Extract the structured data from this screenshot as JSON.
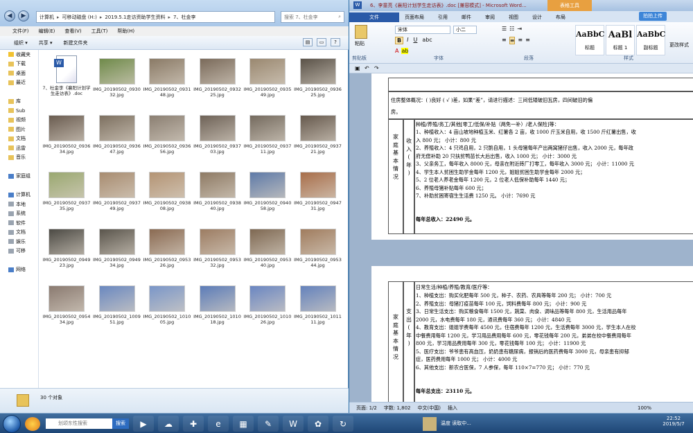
{
  "explorer": {
    "breadcrumb": [
      "计算机",
      "可移动磁盘 (H:)",
      "2019.5.1走访资助学生资料",
      "7、杜金李"
    ],
    "search_placeholder": "搜索 7、杜金李",
    "menu": [
      "文件(F)",
      "编辑(E)",
      "查看(V)",
      "工具(T)",
      "帮助(H)"
    ],
    "toolbar": {
      "organize": "组织 ▾",
      "share": "共享 ▾",
      "new_folder": "新建文件夹"
    },
    "nav": [
      {
        "label": "收藏夹",
        "icon": "star-icon"
      },
      {
        "label": "下载",
        "icon": "folder-icon"
      },
      {
        "label": "桌面",
        "icon": "folder-icon"
      },
      {
        "label": "最近",
        "icon": "folder-icon"
      },
      {
        "label": "",
        "icon": ""
      },
      {
        "label": "库",
        "icon": "library-icon"
      },
      {
        "label": "Sub",
        "icon": "folder-icon"
      },
      {
        "label": "视频",
        "icon": "folder-icon"
      },
      {
        "label": "图片",
        "icon": "folder-icon"
      },
      {
        "label": "文档",
        "icon": "folder-icon"
      },
      {
        "label": "迅雷",
        "icon": "folder-icon"
      },
      {
        "label": "音乐",
        "icon": "folder-icon"
      },
      {
        "label": "",
        "icon": ""
      },
      {
        "label": "家庭组",
        "icon": "homegroup-icon"
      },
      {
        "label": "",
        "icon": ""
      },
      {
        "label": "计算机",
        "icon": "computer-icon"
      },
      {
        "label": "本地",
        "icon": "drive-icon"
      },
      {
        "label": "系统",
        "icon": "drive-icon"
      },
      {
        "label": "软件",
        "icon": "drive-icon"
      },
      {
        "label": "文档",
        "icon": "drive-icon"
      },
      {
        "label": "娱乐",
        "icon": "drive-icon"
      },
      {
        "label": "可移",
        "icon": "drive-icon"
      },
      {
        "label": "",
        "icon": ""
      },
      {
        "label": "网络",
        "icon": "network-icon"
      }
    ],
    "files": [
      {
        "name": "7、杜金李《襄阳计划学生走访表》.doc",
        "kind": "doc"
      },
      {
        "name": "IMG_20190502_093032.jpg",
        "kind": "img",
        "color": "#6f8a4a"
      },
      {
        "name": "IMG_20190502_093148.jpg",
        "kind": "img",
        "color": "#8a7a66"
      },
      {
        "name": "IMG_20190502_093225.jpg",
        "kind": "img",
        "color": "#7a6a5a"
      },
      {
        "name": "IMG_20190502_093549.jpg",
        "kind": "img",
        "color": "#9a8870"
      },
      {
        "name": "IMG_20190502_093625.jpg",
        "kind": "img",
        "color": "#5a5248"
      },
      {
        "name": "IMG_20190502_093634.jpg",
        "kind": "img",
        "color": "#6a5c50"
      },
      {
        "name": "IMG_20190502_093647.jpg",
        "kind": "img",
        "color": "#7d7060"
      },
      {
        "name": "IMG_20190502_093656.jpg",
        "kind": "img",
        "color": "#8b7f72"
      },
      {
        "name": "IMG_20190502_093703.jpg",
        "kind": "img",
        "color": "#6e6257"
      },
      {
        "name": "IMG_20190502_093711.jpg",
        "kind": "img",
        "color": "#746a5e"
      },
      {
        "name": "IMG_20190502_093721.jpg",
        "kind": "img",
        "color": "#66594d"
      },
      {
        "name": "IMG_20190502_093735.jpg",
        "kind": "img",
        "color": "#9aa870"
      },
      {
        "name": "IMG_20190502_093749.jpg",
        "kind": "img",
        "color": "#a88c70"
      },
      {
        "name": "IMG_20190502_093808.jpg",
        "kind": "img",
        "color": "#b49474"
      },
      {
        "name": "IMG_20190502_093840.jpg",
        "kind": "img",
        "color": "#8e7a64"
      },
      {
        "name": "IMG_20190502_094058.jpg",
        "kind": "img",
        "color": "#5e7aa8"
      },
      {
        "name": "IMG_20190502_094731.jpg",
        "kind": "img",
        "color": "#a86e4a"
      },
      {
        "name": "IMG_20190502_094923.jpg",
        "kind": "img",
        "color": "#4c4a44"
      },
      {
        "name": "IMG_20190502_094934.jpg",
        "kind": "img",
        "color": "#5a554c"
      },
      {
        "name": "IMG_20190502_095326.jpg",
        "kind": "img",
        "color": "#8a6a52"
      },
      {
        "name": "IMG_20190502_095332.jpg",
        "kind": "img",
        "color": "#9c7c62"
      },
      {
        "name": "IMG_20190502_095340.jpg",
        "kind": "img",
        "color": "#7e6852"
      },
      {
        "name": "IMG_20190502_095344.jpg",
        "kind": "img",
        "color": "#a07c5e"
      },
      {
        "name": "IMG_20190502_095434.jpg",
        "kind": "img",
        "color": "#8a7a70"
      },
      {
        "name": "IMG_20190502_100951.jpg",
        "kind": "img",
        "color": "#6a88c0"
      },
      {
        "name": "IMG_20190502_101005.jpg",
        "kind": "img",
        "color": "#7a96c8"
      },
      {
        "name": "IMG_20190502_101018.jpg",
        "kind": "img",
        "color": "#5c7cb8"
      },
      {
        "name": "IMG_20190502_101026.jpg",
        "kind": "img",
        "color": "#6a86c2"
      },
      {
        "name": "IMG_20190502_101111.jpg",
        "kind": "img",
        "color": "#6482bc"
      }
    ],
    "status_count": "30 个对象"
  },
  "word": {
    "title": "6、李童亮《襄阳计划学生走访表》.doc [兼容模式] - Microsoft Word...",
    "table_tools": "表格工具",
    "tabs": [
      "文件",
      "开始",
      "插入",
      "页面布局",
      "引用",
      "邮件",
      "审阅",
      "视图",
      "设计",
      "布局"
    ],
    "share": "拍拍上传",
    "ribbon": {
      "paste": "粘贴",
      "clipboard": "剪贴板",
      "font_name": "宋体",
      "font_size": "小二",
      "font_group": "字体",
      "para_group": "段落",
      "styles_group": "样式",
      "styles": [
        {
          "preview": "AaBbC",
          "label": "标题"
        },
        {
          "preview": "AaBl",
          "label": "标题 1"
        },
        {
          "preview": "AaBbC",
          "label": "副标题"
        }
      ],
      "change_styles": "更改样式"
    },
    "page1": {
      "house_line1": "住房整体概况：(  )良好  ( √ )差，如果“差”，请进行描述：三间低矮破旧瓦房，四间破旧的偏",
      "house_line2": "房。",
      "section_label": [
        "家",
        "庭",
        "基",
        "本",
        "情",
        "况"
      ],
      "income_label": [
        "收",
        "入",
        "(",
        "年",
        ")"
      ],
      "income_header": "种植/养殖/务工/其他[零工/低保/补贴（两免一补）/老人保险]等：",
      "income_lines": [
        "1、种植收入：4 亩山坡地种植玉米、红薯各 2 亩，收 1000 斤玉米自用，收 1500 斤红薯出售，收",
        "入 800 元；                                    小计：800 元",
        "2、养殖收入：4 只鸡自用，2 只鹅自用，1 头母猪每年产出两窝猪仔出售，收入 2000 元，每年政",
        "府无偿补助 20 只扶贫鸭苗长大后出售，收入 1000 元；              小计：3000 元",
        "3、父亲务工，每年收入 8000 元，母亲在附近砖厂打零工，每年收入 3000 元；   小计：11000 元",
        "4、学生本人贫困生助学金每年 1200 元，姐姐贫困生助学金每年 2000 元；",
        "5、2 位老人养老金每年 1200 元，2 位老人低保补助每年 1440 元；",
        "6、养殖母猪补贴每年 600 元；",
        "7、补助贫困寄宿生生活费 1250 元。                        小计：7690 元"
      ],
      "income_total": "每年总收入：22490 元。"
    },
    "page2": {
      "section_label": [
        "家",
        "庭",
        "基",
        "本",
        "情",
        "况"
      ],
      "expense_label": [
        "支",
        "出",
        "(",
        "年",
        ")"
      ],
      "expense_header": "日常生活/种植/养殖/教育/医疗等：",
      "expense_lines": [
        "1、种植支出：购买化肥每年 500 元，种子、农药、农具等每年 200 元；     小计：700 元",
        "2、养殖支出：母猪打疫苗每年 100 元，饲料费每年 800 元；              小计：900 元",
        "3、日常生活支出：购买粮食每年 1500 元，蔬菜、肉食、调味品等每年 800 元，生活用品每年",
        "2000 元，水电费每年 180 元，通讯费每年 360 元；                   小计：4840 元",
        "4、教育支出：姐姐学费每年 4500 元，住宿费每年 1200 元，生活费每年 3000 元，学生本人在校",
        "中餐费用每年 1200 元，学习用品费用每年 600 元，零花钱每年 200 元，弟弟在校中餐费用每年",
        "800 元，学习用品费用每年 300 元，零花钱每年 100 元；              小计：11900 元",
        "5、医疗支出：爷爷患有高血压，奶奶患有糖尿病，报销后的医药费每年 3000 元，母亲患有抑郁",
        "症，医药费用每年 1000 元；                                      小计：4000 元",
        "6、其他支出：新农合医保，7 人参保，每年 110×7=770 元；              小计：770 元"
      ],
      "expense_total": "每年总支出：23110 元。"
    },
    "status": [
      "页面: 1/2",
      "字数: 1,802",
      "中文(中国)",
      "插入"
    ],
    "zoom": "100%"
  },
  "taskbar": {
    "search_placeholder": "划颂东性搜索",
    "search_btn": "搜索",
    "tray_text": "温度 读取中...",
    "time": "22:52",
    "date": "2019/5/7"
  },
  "colors": {
    "word_blue": "#2a5aa8",
    "table_tools": "#e8a040",
    "taskbar": "#1e4676"
  }
}
